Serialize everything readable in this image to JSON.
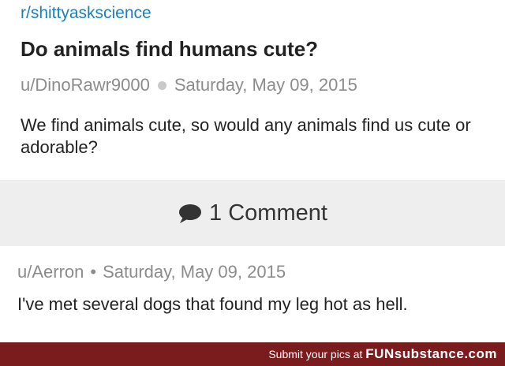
{
  "post": {
    "subreddit": "r/shittyaskscience",
    "title": "Do animals find humans cute?",
    "author": "u/DinoRawr9000",
    "date": "Saturday, May 09, 2015",
    "body": "We find animals cute, so would any animals find us cute or adorable?"
  },
  "comments": {
    "count_label": "1 Comment",
    "icon": "speech-bubble-icon",
    "items": [
      {
        "author": "u/Aerron",
        "separator": "•",
        "date": "Saturday, May 09, 2015",
        "body": "I've met several dogs that found my leg hot as hell."
      }
    ]
  },
  "footer": {
    "text": "Submit your pics at",
    "brand": "FUNsubstance.com"
  },
  "colors": {
    "link": "#1f7fb8",
    "band": "#eeeeee",
    "footer_bg": "#7a1b1d"
  }
}
